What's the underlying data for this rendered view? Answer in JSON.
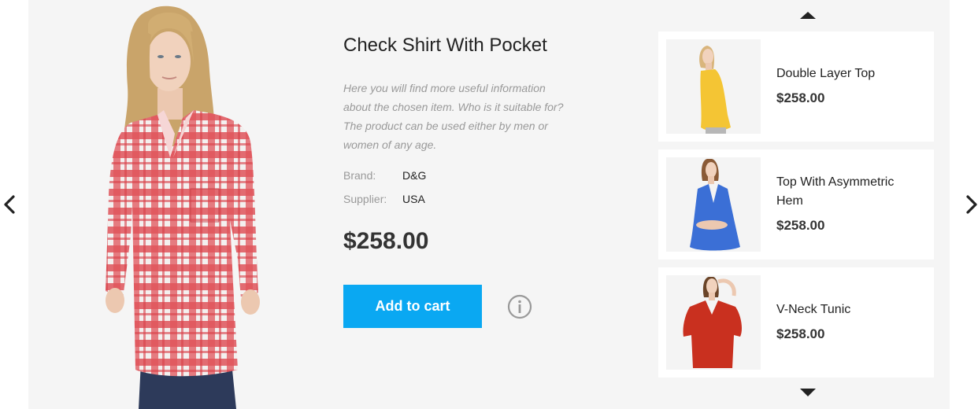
{
  "product": {
    "title": "Check Shirt With Pocket",
    "description": "Here you will find more useful information about the chosen item. Who is it suitable for? The product can be used either by men or women of any age.",
    "brand_label": "Brand:",
    "brand_value": "D&G",
    "supplier_label": "Supplier:",
    "supplier_value": "USA",
    "price": "$258.00",
    "add_to_cart_label": "Add to cart",
    "info_icon": "info-circle-icon"
  },
  "navigation": {
    "prev_icon": "chevron-left-icon",
    "next_icon": "chevron-right-icon",
    "scroll_up_icon": "triangle-up-icon",
    "scroll_down_icon": "triangle-down-icon"
  },
  "related": [
    {
      "name": "Double Layer Top",
      "price": "$258.00",
      "garment_color": "#f4c534"
    },
    {
      "name": "Top With Asymmetric Hem",
      "price": "$258.00",
      "garment_color": "#3b6fd6"
    },
    {
      "name": "V-Neck Tunic",
      "price": "$258.00",
      "garment_color": "#c9301f"
    }
  ],
  "colors": {
    "accent": "#0aa8f2",
    "panel_bg": "#f5f5f5",
    "card_bg": "#ffffff",
    "muted_text": "#999999"
  }
}
